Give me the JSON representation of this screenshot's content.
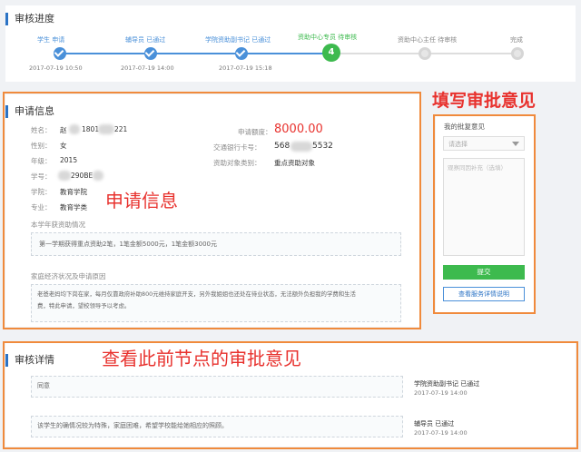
{
  "progress": {
    "title": "审核进度",
    "steps": [
      {
        "label": "学生 申请",
        "date": "2017-07-19 10:50",
        "state": "done"
      },
      {
        "label": "辅导员 已通过",
        "date": "2017-07-19 14:00",
        "state": "done"
      },
      {
        "label": "学院资助副书记 已通过",
        "date": "2017-07-19 15:18",
        "state": "done"
      },
      {
        "label": "资助中心专员 待审核",
        "date": "",
        "state": "current",
        "number": "4"
      },
      {
        "label": "资助中心主任 待审核",
        "date": "",
        "state": "pending"
      },
      {
        "label": "完成",
        "date": "",
        "state": "pending"
      }
    ]
  },
  "info": {
    "title": "申请信息",
    "name_label": "姓名：",
    "name_value": "赵",
    "phone_prefix": "1801",
    "phone_suffix": "221",
    "gender_label": "性别：",
    "gender_value": "女",
    "grade_label": "年级：",
    "grade_value": "2015",
    "id_label": "学号：",
    "id_value": "290BE",
    "college_label": "学院：",
    "college_value": "教育学院",
    "major_label": "专业：",
    "major_value": "教育学类",
    "amount_label": "申请额度：",
    "amount_value": "8000.00",
    "bank_label": "交通银行卡号：",
    "bank_prefix": "568",
    "bank_suffix": "5532",
    "category_label": "资助对象类别：",
    "category_value": "重点资助对象",
    "history_title": "本学年获资助情况",
    "history_text": "第一学期获得重点资助2笔，1笔金额5000元，1笔金额3000元",
    "reason_title": "家庭经济状况及申请原因",
    "reason_text_1": "老爸老妈均下岗在家，每月仅靠政府补助800元维持家庭开支，另外我姐姐也还处在待业状态，无法额外负担我的学费和生活",
    "reason_text_2": "费，特此申请，望校领导予以考虑。"
  },
  "approval": {
    "title": "我的批复意见",
    "select_placeholder": "请选择",
    "textarea_placeholder": "观察同因补充（选填）",
    "submit_label": "提交",
    "service_label": "查看服务详情说明"
  },
  "details": {
    "title": "审核详情",
    "records": [
      {
        "comment": "同意",
        "reviewer": "学院资助副书记 已通过",
        "date": "2017-07-19 14:00"
      },
      {
        "comment": "该学生的确情况较为特殊，家庭困难，希望学校能给她相应的照顾。",
        "reviewer": "辅导员 已通过",
        "date": "2017-07-19 14:00"
      }
    ]
  },
  "annotations": {
    "info": "申请信息",
    "approval": "填写审批意见",
    "details": "查看此前节点的审批意见"
  },
  "colors": {
    "done": "#4a90d9",
    "current": "#3dba4e",
    "pending": "#d0d0d0",
    "amount": "#e8322e",
    "submit": "#3dba4e",
    "annotation": "#e8322e"
  }
}
